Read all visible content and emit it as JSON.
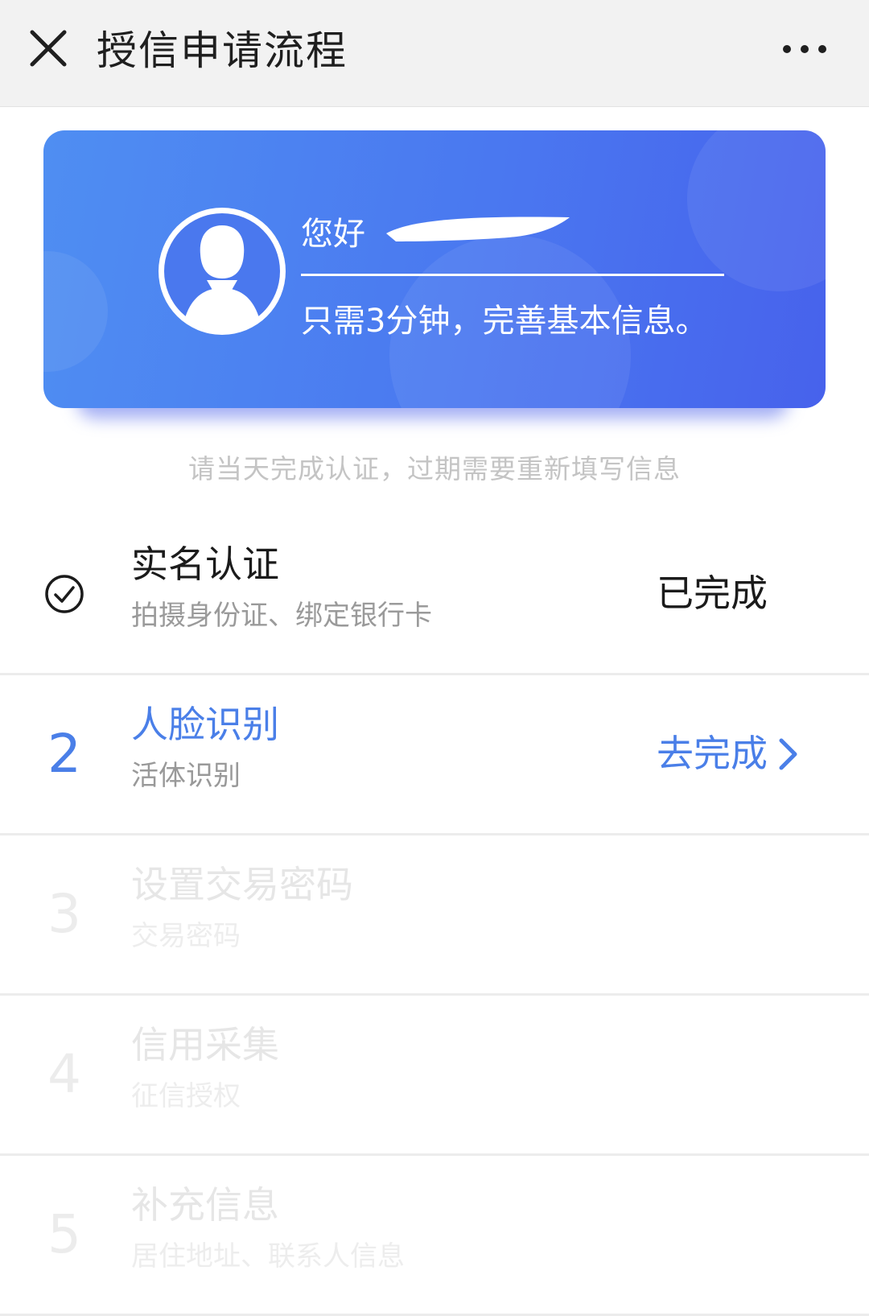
{
  "header": {
    "title": "授信申请流程",
    "close_icon": "close-icon",
    "more_icon": "more-dots-icon"
  },
  "banner": {
    "greeting": "您好",
    "subtitle": "只需3分钟，完善基本信息。",
    "avatar_icon": "user-avatar-icon",
    "gradient_colors": [
      "#4f8ef2",
      "#4762ec"
    ]
  },
  "notice": "请当天完成认证，过期需要重新填写信息",
  "steps": [
    {
      "marker": "",
      "title": "实名认证",
      "desc": "拍摄身份证、绑定银行卡",
      "status": "已完成",
      "state": "done"
    },
    {
      "marker": "2",
      "title": "人脸识别",
      "desc": "活体识别",
      "status": "去完成",
      "state": "active"
    },
    {
      "marker": "3",
      "title": "设置交易密码",
      "desc": "交易密码",
      "status": "",
      "state": "pending"
    },
    {
      "marker": "4",
      "title": "信用采集",
      "desc": "征信授权",
      "status": "",
      "state": "pending"
    },
    {
      "marker": "5",
      "title": "补充信息",
      "desc": "居住地址、联系人信息",
      "status": "",
      "state": "pending"
    }
  ],
  "colors": {
    "accent": "#4a7fe8",
    "pending": "#e6e6e6",
    "header_bg": "#f2f2f2"
  }
}
